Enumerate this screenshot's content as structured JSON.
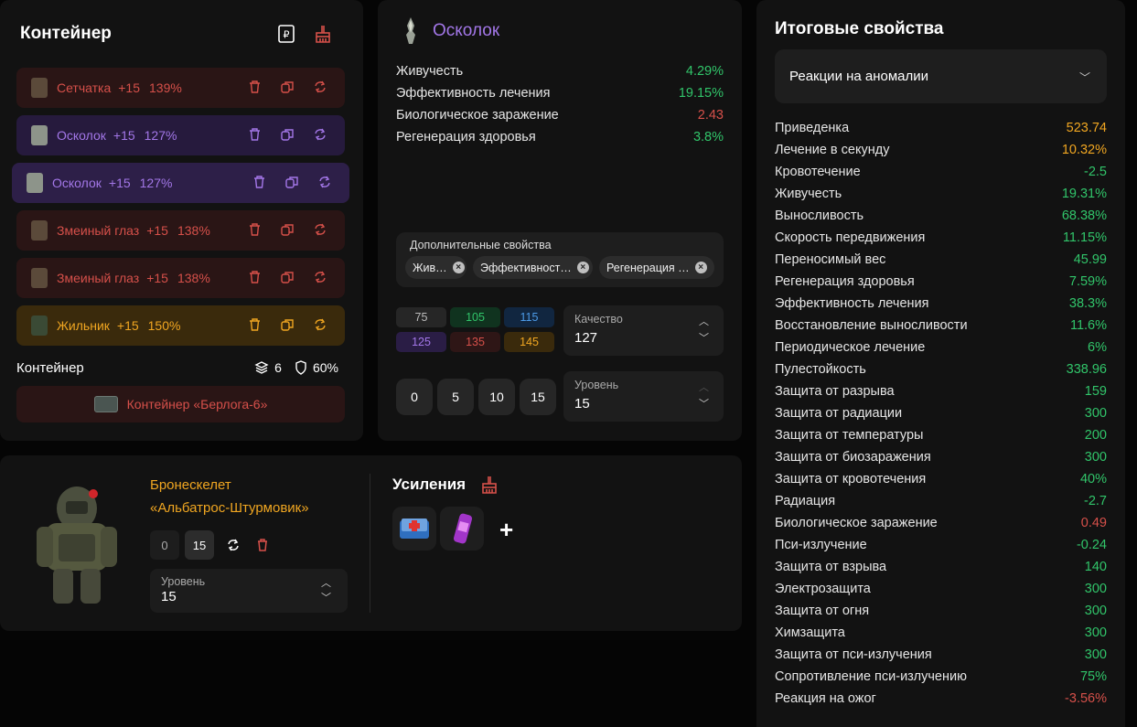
{
  "container": {
    "title": "Контейнер",
    "artifacts": [
      {
        "name": "Сетчатка",
        "level": "+15",
        "percent": "139%",
        "theme": "red"
      },
      {
        "name": "Осколок",
        "level": "+15",
        "percent": "127%",
        "theme": "purple"
      },
      {
        "name": "Осколок",
        "level": "+15",
        "percent": "127%",
        "theme": "purple"
      },
      {
        "name": "Змеиный глаз",
        "level": "+15",
        "percent": "138%",
        "theme": "red"
      },
      {
        "name": "Змеиный глаз",
        "level": "+15",
        "percent": "138%",
        "theme": "red"
      },
      {
        "name": "Жильник",
        "level": "+15",
        "percent": "150%",
        "theme": "orange"
      }
    ],
    "summary_label": "Контейнер",
    "slots": "6",
    "protection": "60%",
    "container_name": "Контейнер «Берлога-6»"
  },
  "artifact": {
    "title": "Осколок",
    "props": [
      {
        "name": "Живучесть",
        "value": "4.29%",
        "color": "g"
      },
      {
        "name": "Эффективность лечения",
        "value": "19.15%",
        "color": "g"
      },
      {
        "name": "Биологическое заражение",
        "value": "2.43",
        "color": "r"
      },
      {
        "name": "Регенерация здоровья",
        "value": "3.8%",
        "color": "g"
      }
    ],
    "extra_label": "Дополнительные свойства",
    "chips": [
      "Жив…",
      "Эффективност…",
      "Регенерация …"
    ],
    "quality_presets": [
      {
        "v": "75",
        "bg": "#262626",
        "fg": "#bbbbbb"
      },
      {
        "v": "105",
        "bg": "#10331f",
        "fg": "#31c56a"
      },
      {
        "v": "115",
        "bg": "#112640",
        "fg": "#4d9be8"
      },
      {
        "v": "125",
        "bg": "#2a1d45",
        "fg": "#a377e8"
      },
      {
        "v": "135",
        "bg": "#2e1616",
        "fg": "#d6504a"
      },
      {
        "v": "145",
        "bg": "#3a2a0c",
        "fg": "#f0a621"
      }
    ],
    "quality_label": "Качество",
    "quality_value": "127",
    "level_presets": [
      "0",
      "5",
      "10",
      "15"
    ],
    "level_label": "Уровень",
    "level_value": "15"
  },
  "armor": {
    "name_line1": "Бронескелет",
    "name_line2": "«Альбатрос-Штурмовик»",
    "lvl_a": "0",
    "lvl_b": "15",
    "level_label": "Уровень",
    "level_value": "15",
    "boosts_title": "Усиления",
    "plus": "+"
  },
  "final": {
    "title": "Итоговые свойства",
    "select_value": "Реакции на аномалии",
    "props": [
      {
        "name": "Приведенка",
        "value": "523.74",
        "color": "o"
      },
      {
        "name": "Лечение в секунду",
        "value": "10.32%",
        "color": "o"
      },
      {
        "name": "Кровотечение",
        "value": "-2.5",
        "color": "g"
      },
      {
        "name": "Живучесть",
        "value": "19.31%",
        "color": "g"
      },
      {
        "name": "Выносливость",
        "value": "68.38%",
        "color": "g"
      },
      {
        "name": "Скорость передвижения",
        "value": "11.15%",
        "color": "g"
      },
      {
        "name": "Переносимый вес",
        "value": "45.99",
        "color": "g"
      },
      {
        "name": "Регенерация здоровья",
        "value": "7.59%",
        "color": "g"
      },
      {
        "name": "Эффективность лечения",
        "value": "38.3%",
        "color": "g"
      },
      {
        "name": "Восстановление выносливости",
        "value": "11.6%",
        "color": "g"
      },
      {
        "name": "Периодическое лечение",
        "value": "6%",
        "color": "g"
      },
      {
        "name": "Пулестойкость",
        "value": "338.96",
        "color": "g"
      },
      {
        "name": "Защита от разрыва",
        "value": "159",
        "color": "g"
      },
      {
        "name": "Защита от радиации",
        "value": "300",
        "color": "g"
      },
      {
        "name": "Защита от температуры",
        "value": "200",
        "color": "g"
      },
      {
        "name": "Защита от биозаражения",
        "value": "300",
        "color": "g"
      },
      {
        "name": "Защита от кровотечения",
        "value": "40%",
        "color": "g"
      },
      {
        "name": "Радиация",
        "value": "-2.7",
        "color": "g"
      },
      {
        "name": "Биологическое заражение",
        "value": "0.49",
        "color": "r"
      },
      {
        "name": "Пси-излучение",
        "value": "-0.24",
        "color": "g"
      },
      {
        "name": "Защита от взрыва",
        "value": "140",
        "color": "g"
      },
      {
        "name": "Электрозащита",
        "value": "300",
        "color": "g"
      },
      {
        "name": "Защита от огня",
        "value": "300",
        "color": "g"
      },
      {
        "name": "Химзащита",
        "value": "300",
        "color": "g"
      },
      {
        "name": "Защита от пси-излучения",
        "value": "300",
        "color": "g"
      },
      {
        "name": "Сопротивление пси-излучению",
        "value": "75%",
        "color": "g"
      },
      {
        "name": "Реакция на ожог",
        "value": "-3.56%",
        "color": "r"
      }
    ]
  }
}
